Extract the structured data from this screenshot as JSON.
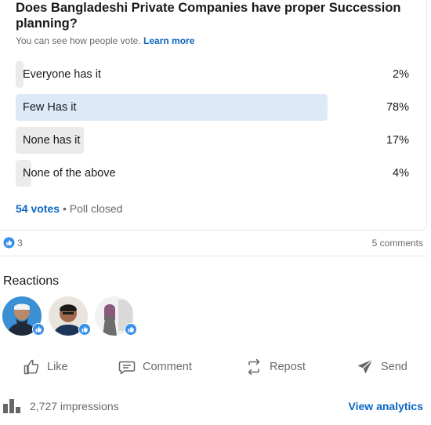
{
  "poll": {
    "question": "Does Bangladeshi Private Companies have proper Succession planning?",
    "visibility_note": "You can see how people vote.",
    "learn_more": "Learn more",
    "options": [
      {
        "label": "Everyone has it",
        "percent_text": "2%",
        "percent": 2,
        "selected": false
      },
      {
        "label": "Few Has it",
        "percent_text": "78%",
        "percent": 78,
        "selected": true
      },
      {
        "label": "None has it",
        "percent_text": "17%",
        "percent": 17,
        "selected": false
      },
      {
        "label": "None of the above",
        "percent_text": "4%",
        "percent": 4,
        "selected": false
      }
    ],
    "votes": "54 votes",
    "separator": "•",
    "status": "Poll closed"
  },
  "social": {
    "like_count": "3",
    "comments": "5 comments"
  },
  "reactions": {
    "title": "Reactions",
    "avatars": [
      "avatar-person-1",
      "avatar-person-2",
      "avatar-person-3"
    ]
  },
  "actions": {
    "like": "Like",
    "comment": "Comment",
    "repost": "Repost",
    "send": "Send"
  },
  "analytics": {
    "impressions": "2,727 impressions",
    "view_analytics": "View analytics"
  },
  "colors": {
    "brand_blue": "#0a66c2",
    "selected_fill": "#dde9f7",
    "option_fill": "#ebebeb",
    "muted_text": "#666666"
  }
}
